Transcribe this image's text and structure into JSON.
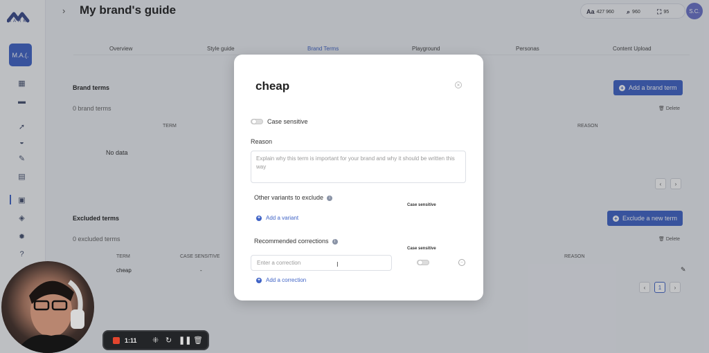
{
  "brand": {
    "logo_text": "MARK",
    "workspace_label": "M.A.(."
  },
  "header": {
    "title": "My brand's guide",
    "avatar": "S.C."
  },
  "stats": {
    "words": "427 960",
    "searches": "960",
    "scans": "95"
  },
  "tabs": [
    "Overview",
    "Style guide",
    "Brand Terms",
    "Playground",
    "Personas",
    "Content Upload"
  ],
  "active_tab": "Brand Terms",
  "brand_terms": {
    "title": "Brand terms",
    "count": "0 brand terms",
    "add_button": "Add a brand term",
    "delete": "Delete",
    "columns": [
      "TERM",
      "REASON"
    ],
    "empty": "No data"
  },
  "excluded_terms": {
    "title": "Excluded terms",
    "count": "0 excluded terms",
    "add_button": "Exclude a new term",
    "delete": "Delete",
    "columns": [
      "TERM",
      "CASE SENSITIVE",
      "REASON"
    ],
    "rows": [
      {
        "term": "cheap",
        "case_sensitive": "-"
      }
    ],
    "page": "1"
  },
  "modal": {
    "title": "cheap",
    "case_sensitive_label": "Case sensitive",
    "reason_label": "Reason",
    "reason_placeholder": "Explain why this term is important for your brand and why it should be written this way",
    "variants_label": "Other variants to exclude",
    "variants_case_head": "Case sensitive",
    "add_variant": "Add a variant",
    "corrections_label": "Recommended corrections",
    "corrections_case_head": "Case sensitive",
    "correction_placeholder": "Enter a correction",
    "add_correction": "Add a correction"
  },
  "recorder": {
    "time": "1:11"
  },
  "colors": {
    "accent": "#3f63c6",
    "record": "#e2452e"
  }
}
